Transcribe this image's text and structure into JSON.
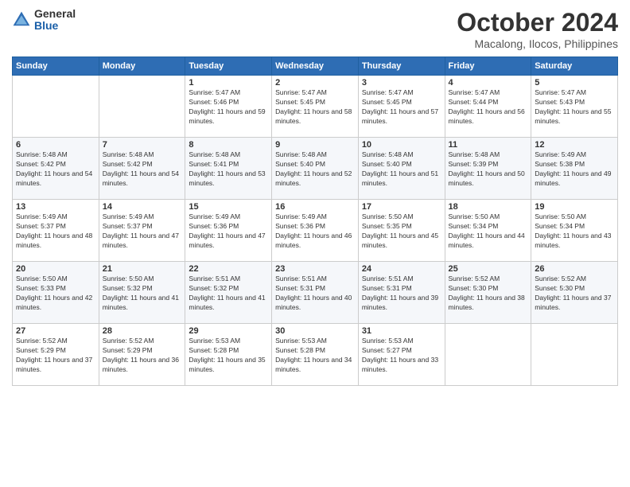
{
  "logo": {
    "general": "General",
    "blue": "Blue"
  },
  "header": {
    "month": "October 2024",
    "location": "Macalong, Ilocos, Philippines"
  },
  "weekdays": [
    "Sunday",
    "Monday",
    "Tuesday",
    "Wednesday",
    "Thursday",
    "Friday",
    "Saturday"
  ],
  "weeks": [
    [
      {
        "day": "",
        "info": ""
      },
      {
        "day": "",
        "info": ""
      },
      {
        "day": "1",
        "info": "Sunrise: 5:47 AM\nSunset: 5:46 PM\nDaylight: 11 hours and 59 minutes."
      },
      {
        "day": "2",
        "info": "Sunrise: 5:47 AM\nSunset: 5:45 PM\nDaylight: 11 hours and 58 minutes."
      },
      {
        "day": "3",
        "info": "Sunrise: 5:47 AM\nSunset: 5:45 PM\nDaylight: 11 hours and 57 minutes."
      },
      {
        "day": "4",
        "info": "Sunrise: 5:47 AM\nSunset: 5:44 PM\nDaylight: 11 hours and 56 minutes."
      },
      {
        "day": "5",
        "info": "Sunrise: 5:47 AM\nSunset: 5:43 PM\nDaylight: 11 hours and 55 minutes."
      }
    ],
    [
      {
        "day": "6",
        "info": "Sunrise: 5:48 AM\nSunset: 5:42 PM\nDaylight: 11 hours and 54 minutes."
      },
      {
        "day": "7",
        "info": "Sunrise: 5:48 AM\nSunset: 5:42 PM\nDaylight: 11 hours and 54 minutes."
      },
      {
        "day": "8",
        "info": "Sunrise: 5:48 AM\nSunset: 5:41 PM\nDaylight: 11 hours and 53 minutes."
      },
      {
        "day": "9",
        "info": "Sunrise: 5:48 AM\nSunset: 5:40 PM\nDaylight: 11 hours and 52 minutes."
      },
      {
        "day": "10",
        "info": "Sunrise: 5:48 AM\nSunset: 5:40 PM\nDaylight: 11 hours and 51 minutes."
      },
      {
        "day": "11",
        "info": "Sunrise: 5:48 AM\nSunset: 5:39 PM\nDaylight: 11 hours and 50 minutes."
      },
      {
        "day": "12",
        "info": "Sunrise: 5:49 AM\nSunset: 5:38 PM\nDaylight: 11 hours and 49 minutes."
      }
    ],
    [
      {
        "day": "13",
        "info": "Sunrise: 5:49 AM\nSunset: 5:37 PM\nDaylight: 11 hours and 48 minutes."
      },
      {
        "day": "14",
        "info": "Sunrise: 5:49 AM\nSunset: 5:37 PM\nDaylight: 11 hours and 47 minutes."
      },
      {
        "day": "15",
        "info": "Sunrise: 5:49 AM\nSunset: 5:36 PM\nDaylight: 11 hours and 47 minutes."
      },
      {
        "day": "16",
        "info": "Sunrise: 5:49 AM\nSunset: 5:36 PM\nDaylight: 11 hours and 46 minutes."
      },
      {
        "day": "17",
        "info": "Sunrise: 5:50 AM\nSunset: 5:35 PM\nDaylight: 11 hours and 45 minutes."
      },
      {
        "day": "18",
        "info": "Sunrise: 5:50 AM\nSunset: 5:34 PM\nDaylight: 11 hours and 44 minutes."
      },
      {
        "day": "19",
        "info": "Sunrise: 5:50 AM\nSunset: 5:34 PM\nDaylight: 11 hours and 43 minutes."
      }
    ],
    [
      {
        "day": "20",
        "info": "Sunrise: 5:50 AM\nSunset: 5:33 PM\nDaylight: 11 hours and 42 minutes."
      },
      {
        "day": "21",
        "info": "Sunrise: 5:50 AM\nSunset: 5:32 PM\nDaylight: 11 hours and 41 minutes."
      },
      {
        "day": "22",
        "info": "Sunrise: 5:51 AM\nSunset: 5:32 PM\nDaylight: 11 hours and 41 minutes."
      },
      {
        "day": "23",
        "info": "Sunrise: 5:51 AM\nSunset: 5:31 PM\nDaylight: 11 hours and 40 minutes."
      },
      {
        "day": "24",
        "info": "Sunrise: 5:51 AM\nSunset: 5:31 PM\nDaylight: 11 hours and 39 minutes."
      },
      {
        "day": "25",
        "info": "Sunrise: 5:52 AM\nSunset: 5:30 PM\nDaylight: 11 hours and 38 minutes."
      },
      {
        "day": "26",
        "info": "Sunrise: 5:52 AM\nSunset: 5:30 PM\nDaylight: 11 hours and 37 minutes."
      }
    ],
    [
      {
        "day": "27",
        "info": "Sunrise: 5:52 AM\nSunset: 5:29 PM\nDaylight: 11 hours and 37 minutes."
      },
      {
        "day": "28",
        "info": "Sunrise: 5:52 AM\nSunset: 5:29 PM\nDaylight: 11 hours and 36 minutes."
      },
      {
        "day": "29",
        "info": "Sunrise: 5:53 AM\nSunset: 5:28 PM\nDaylight: 11 hours and 35 minutes."
      },
      {
        "day": "30",
        "info": "Sunrise: 5:53 AM\nSunset: 5:28 PM\nDaylight: 11 hours and 34 minutes."
      },
      {
        "day": "31",
        "info": "Sunrise: 5:53 AM\nSunset: 5:27 PM\nDaylight: 11 hours and 33 minutes."
      },
      {
        "day": "",
        "info": ""
      },
      {
        "day": "",
        "info": ""
      }
    ]
  ]
}
